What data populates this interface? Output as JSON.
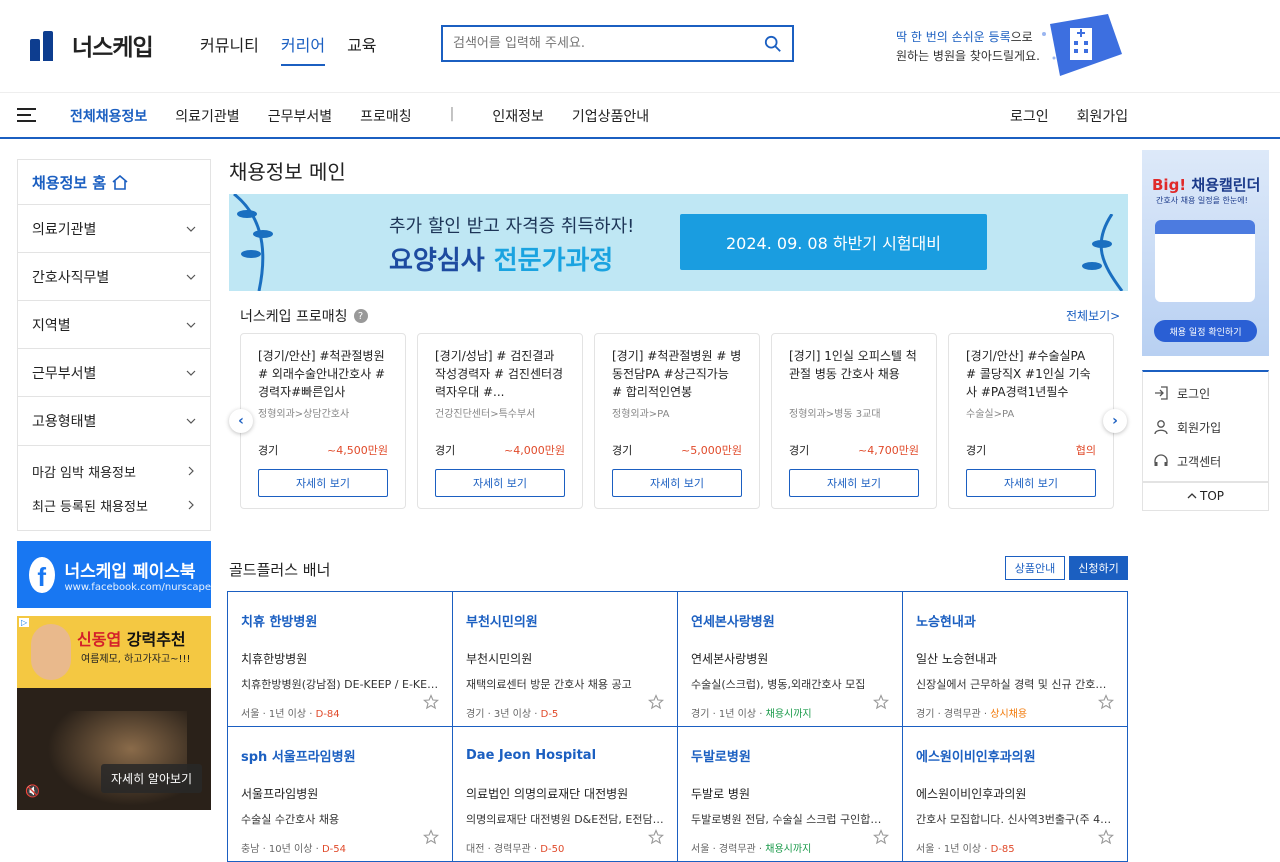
{
  "header": {
    "logo_text": "너스케입",
    "nav": [
      "커뮤니티",
      "커리어",
      "교육"
    ],
    "search_placeholder": "검색어를 입력해 주세요.",
    "promo_line1_highlight": "딱 한 번의 손쉬운 등록",
    "promo_line1_rest": "으로",
    "promo_line2": "원하는 병원을 찾아드릴게요."
  },
  "gnb": {
    "items": [
      "전체채용정보",
      "의료기관별",
      "근무부서별",
      "프로매칭",
      "|",
      "인재정보",
      "기업상품안내"
    ],
    "login": "로그인",
    "signup": "회원가입"
  },
  "sidebar": {
    "home": "채용정보 홈",
    "items": [
      "의료기관별",
      "간호사직무별",
      "지역별",
      "근무부서별",
      "고용형태별"
    ],
    "sub_items": [
      "마감 임박 채용정보",
      "최근 등록된 채용정보"
    ],
    "facebook_title": "너스케입 페이스북",
    "facebook_url": "www.facebook.com/nurscape",
    "ad_headline_name": "신동엽",
    "ad_headline_rest": "강력추천",
    "ad_subline": "여름제모, 하고가자고~!!!",
    "ad_button": "자세히 알아보기"
  },
  "main": {
    "title": "채용정보 메인",
    "banner": {
      "line1": "추가 할인 받고 자격증 취득하자!",
      "line2a": "요양심사",
      "line2b": "전문가과정",
      "button": "2024. 09. 08 하반기 시험대비"
    },
    "promatch_title": "너스케입 프로매칭",
    "promatch_more": "전체보기>",
    "cards": [
      {
        "title": "[경기/안산] #척관절병원 # 외래수술안내간호사 # 경력자#빠른입사",
        "category": "정형외과>상담간호사",
        "location": "경기",
        "pay": "~4,500만원",
        "button": "자세히 보기"
      },
      {
        "title": "[경기/성남] # 검진결과작성경력자 # 검진센터경력자우대 #...",
        "category": "건강진단센터>특수부서",
        "location": "경기",
        "pay": "~4,000만원",
        "button": "자세히 보기"
      },
      {
        "title": "[경기] #척관절병원 # 병동전담PA #상근직가능 # 합리적인연봉",
        "category": "정형외과>PA",
        "location": "경기",
        "pay": "~5,000만원",
        "button": "자세히 보기"
      },
      {
        "title": "[경기] 1인실 오피스텔 척관절 병동 간호사 채용",
        "category": "정형외과>병동 3교대",
        "location": "경기",
        "pay": "~4,700만원",
        "button": "자세히 보기"
      },
      {
        "title": "[경기/안산] #수술실PA # 콜당직X #1인실 기숙사 #PA경력1년필수",
        "category": "수술실>PA",
        "location": "경기",
        "pay": "협의",
        "button": "자세히 보기"
      }
    ],
    "goldplus_title": "골드플러스 배너",
    "goldplus_btn1": "상품안내",
    "goldplus_btn2": "신청하기",
    "goldplus": [
      {
        "logo": "치휴 한방병원",
        "name": "치휴한방병원",
        "desc": "치휴한방병원(강남점) DE-KEEP / E-KEEP...",
        "meta": "서울 · 1년 이상 · ",
        "tag": "D-84",
        "tag_type": "dl"
      },
      {
        "logo": "부천시민의원",
        "name": "부천시민의원",
        "desc": "재택의료센터 방문 간호사 채용 공고",
        "meta": "경기 · 3년 이상 · ",
        "tag": "D-5",
        "tag_type": "dl"
      },
      {
        "logo": "연세본사랑병원",
        "name": "연세본사랑병원",
        "desc": "수술실(스크럽), 병동,외래간호사 모집",
        "meta": "경기 · 1년 이상 · ",
        "tag": "채용시까지",
        "tag_type": "gr"
      },
      {
        "logo": "노승현내과",
        "name": "일산 노승현내과",
        "desc": "신장실에서 근무하실 경력 및 신규 간호사 선...",
        "meta": "경기 · 경력무관 · ",
        "tag": "상시채용",
        "tag_type": "or"
      },
      {
        "logo": "sph 서울프라임병원",
        "name": "서울프라임병원",
        "desc": "수술실 수간호사 채용",
        "meta": "충남 · 10년 이상 · ",
        "tag": "D-54",
        "tag_type": "dl"
      },
      {
        "logo": "Dae Jeon Hospital",
        "name": "의료법인 의명의료재단 대전병원",
        "desc": "의명의료재단 대전병원 D&E전담, E전담 간...",
        "meta": "대전 · 경력무관 · ",
        "tag": "D-50",
        "tag_type": "dl"
      },
      {
        "logo": "두발로병원",
        "name": "두발로 병원",
        "desc": "두발로병원 전담, 수술실 스크럽 구인합니다",
        "meta": "서울 · 경력무관 · ",
        "tag": "채용시까지",
        "tag_type": "gr"
      },
      {
        "logo": "에스원이비인후과의원",
        "name": "에스원이비인후과의원",
        "desc": "간호사 모집합니다. 신사역3번출구(주 41시...",
        "meta": "서울 · 1년 이상 · ",
        "tag": "D-85",
        "tag_type": "dl"
      }
    ]
  },
  "right": {
    "banner_title_a": "Big!",
    "banner_title_b": "채용캘린더",
    "banner_sub": "간호사 채용 일정을 한눈에!",
    "banner_btn": "채용 일정 확인하기",
    "links": [
      "로그인",
      "회원가입",
      "고객센터"
    ],
    "top": "TOP"
  },
  "colors": {
    "brand": "#1b5fc1",
    "deadline": "#e04a2a",
    "always": "#1a9a4a",
    "regular": "#f27a0a"
  }
}
